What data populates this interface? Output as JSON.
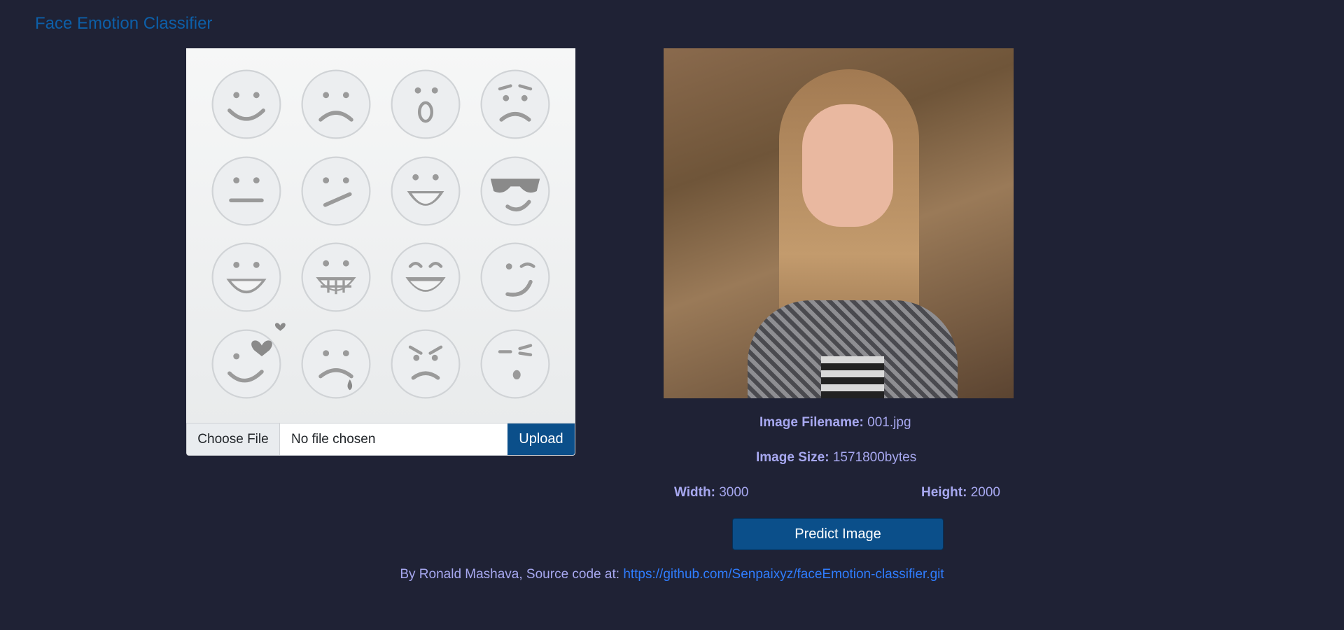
{
  "app": {
    "brand": "Face Emotion Classifier"
  },
  "upload": {
    "choose_label": "Choose File",
    "file_status": "No file chosen",
    "upload_label": "Upload"
  },
  "preview": {
    "filename_label": "Image Filename:",
    "filename_value": "001.jpg",
    "size_label": "Image Size:",
    "size_value": "1571800bytes",
    "width_label": "Width:",
    "width_value": "3000",
    "height_label": "Height:",
    "height_value": "2000",
    "predict_label": "Predict Image"
  },
  "footer": {
    "text": "By Ronald Mashava, Source code at: ",
    "link_text": "https://github.com/Senpaixyz/faceEmotion-classifier.git"
  },
  "emojis": [
    "happy",
    "sad",
    "surprised",
    "worried",
    "neutral",
    "skeptical",
    "grinning",
    "cool",
    "laughing",
    "big-grin",
    "joyful",
    "wink",
    "in-love",
    "crying",
    "angry",
    "smug"
  ]
}
